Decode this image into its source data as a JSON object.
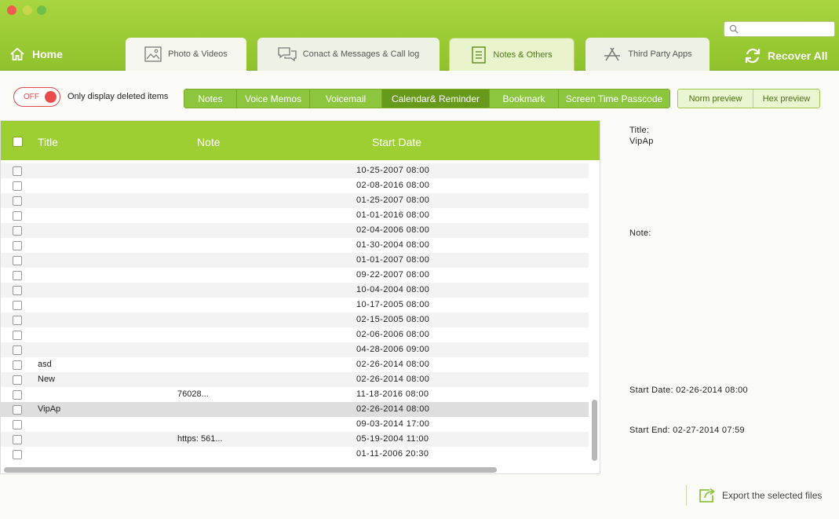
{
  "header": {
    "home_label": "Home",
    "recover_label": "Recover  All",
    "search": {
      "value": "",
      "placeholder": ""
    },
    "tabs": [
      {
        "label": "Photo & Videos",
        "icon": "photo-icon"
      },
      {
        "label": "Conact & Messages & Call log",
        "icon": "chat-icon"
      },
      {
        "label": "Notes & Others",
        "icon": "notes-icon"
      },
      {
        "label": "Third Party Apps",
        "icon": "apps-icon"
      }
    ]
  },
  "toolbar": {
    "toggle_label": "OFF",
    "only_deleted_label": "Only display deleted items",
    "categories": [
      {
        "label": "Notes"
      },
      {
        "label": "Voice Memos"
      },
      {
        "label": "Voicemail"
      },
      {
        "label": "Calendar& Reminder"
      },
      {
        "label": "Bookmark"
      },
      {
        "label": "Screen Time Passcode"
      }
    ],
    "active_category": "Calendar& Reminder",
    "preview": [
      {
        "label": "Norm preview"
      },
      {
        "label": "Hex preview"
      }
    ]
  },
  "table": {
    "headers": {
      "title": "Title",
      "note": "Note",
      "start": "Start Date"
    },
    "rows": [
      {
        "title": "",
        "note": "",
        "date": "10-25-2007 08:00"
      },
      {
        "title": "",
        "note": "",
        "date": "02-08-2016 08:00"
      },
      {
        "title": "",
        "note": "",
        "date": "01-25-2007 08:00"
      },
      {
        "title": "",
        "note": "",
        "date": "01-01-2016 08:00"
      },
      {
        "title": "",
        "note": "",
        "date": "02-04-2006 08:00"
      },
      {
        "title": "",
        "note": "",
        "date": "01-30-2004 08:00"
      },
      {
        "title": "",
        "note": "",
        "date": "01-01-2007 08:00"
      },
      {
        "title": "",
        "note": "",
        "date": "09-22-2007 08:00"
      },
      {
        "title": "",
        "note": "",
        "date": "10-04-2004 08:00"
      },
      {
        "title": "",
        "note": "",
        "date": "10-17-2005 08:00"
      },
      {
        "title": "",
        "note": "",
        "date": "02-15-2005 08:00"
      },
      {
        "title": "",
        "note": "",
        "date": "02-06-2006 08:00"
      },
      {
        "title": "",
        "note": "",
        "date": "04-28-2006 09:00"
      },
      {
        "title": "asd",
        "note": "",
        "date": "02-26-2014 08:00"
      },
      {
        "title": "New",
        "note": "",
        "date": "02-26-2014 08:00"
      },
      {
        "title": "",
        "note": "76028...",
        "date": "11-18-2016 08:00"
      },
      {
        "title": "VipAp",
        "note": "",
        "date": "02-26-2014 08:00"
      },
      {
        "title": "",
        "note": "",
        "date": "09-03-2014 17:00"
      },
      {
        "title": "",
        "note": "https:  561...",
        "date": "05-19-2004 11:00"
      },
      {
        "title": "",
        "note": "",
        "date": "01-11-2006 20:30"
      }
    ]
  },
  "detail": {
    "title_label": "Title:",
    "title_value": "VipAp",
    "note_label": "Note:",
    "note_value": "",
    "start_date_label": "Start Date:",
    "start_date_value": "02-26-2014 08:00",
    "start_end_label": "Start End:",
    "start_end_value": "02-27-2014 07:59"
  },
  "export_label": "Export the selected files",
  "colors": {
    "brand_green": "#9dcf33",
    "active_segment": "#679a1a",
    "toggle_red": "#e04848"
  }
}
